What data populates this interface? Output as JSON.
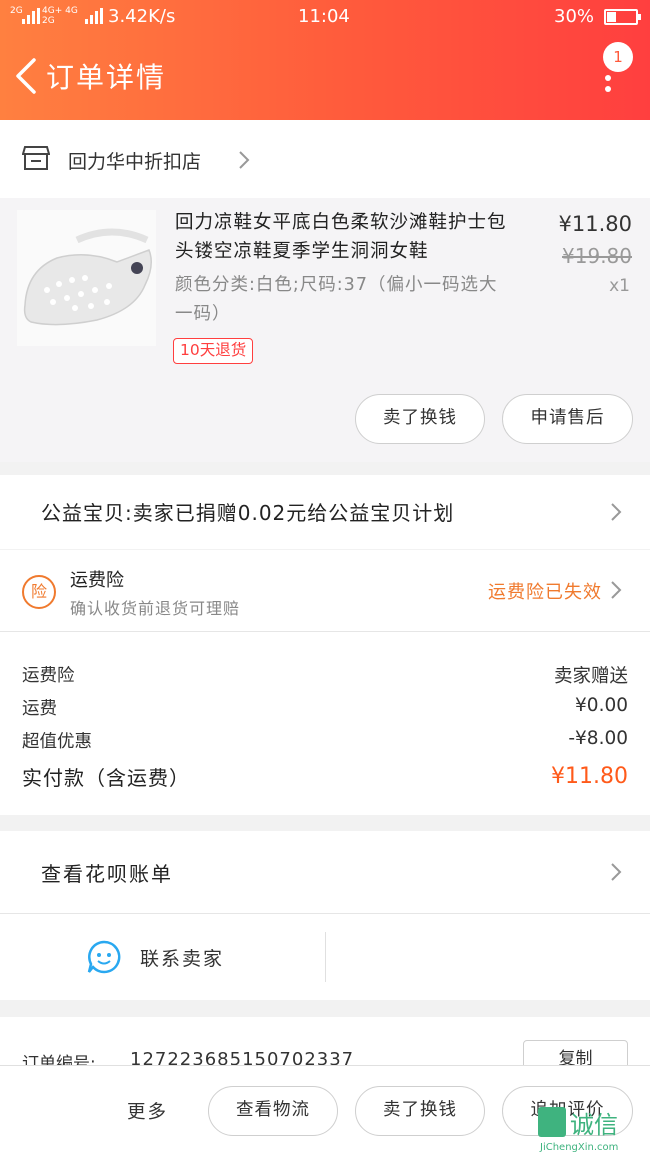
{
  "status_bar": {
    "signal_label": "2G",
    "network_label": "4G+ 4G 2G",
    "speed": "3.42K/s",
    "time": "11:04",
    "battery": "30%"
  },
  "nav": {
    "title": "订单详情",
    "badge_count": "1"
  },
  "shop": {
    "name": "回力华中折扣店"
  },
  "product": {
    "title": "回力凉鞋女平底白色柔软沙滩鞋护士包头镂空凉鞋夏季学生洞洞女鞋",
    "spec": "颜色分类:白色;尺码:37（偏小一码选大一码）",
    "price": "¥11.80",
    "original_price": "¥19.80",
    "quantity": "x1",
    "tag": "10天退货",
    "buttons": {
      "sell_label": "卖了换钱",
      "aftersale_label": "申请售后"
    }
  },
  "charity": {
    "text": "公益宝贝:卖家已捐赠0.02元给公益宝贝计划"
  },
  "insurance": {
    "icon_char": "险",
    "title": "运费险",
    "subtitle": "确认收货前退货可理赔",
    "status": "运费险已失效",
    "accent_color": "#f07a2e"
  },
  "fees": {
    "rows": [
      {
        "label": "运费险",
        "value": "卖家赠送"
      },
      {
        "label": "运费",
        "value": "¥0.00"
      },
      {
        "label": "超值优惠",
        "value": "-¥8.00"
      }
    ],
    "paid_label": "实付款（含运费）",
    "paid_value": "¥11.80",
    "paid_color": "#ff5a1a"
  },
  "huabei": {
    "text": "查看花呗账单"
  },
  "contact": {
    "text": "联系卖家",
    "icon": "chat-bubble-icon"
  },
  "order": {
    "label": "订单编号:",
    "number": "127223685150702337",
    "copy_label": "复制"
  },
  "bottom": {
    "more_label": "更多",
    "logistics_label": "查看物流",
    "sell_label": "卖了换钱",
    "review_label": "追加评价"
  },
  "watermark": {
    "cn": "诚信",
    "en": "JiChengXin.com"
  },
  "colors": {
    "header_gradient_start": "#ff8040",
    "header_gradient_end": "#ff3f3f"
  }
}
